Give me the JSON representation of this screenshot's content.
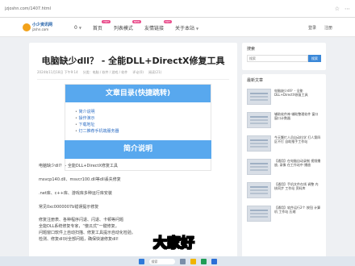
{
  "browser": {
    "url": "jzjoshn.com/1407.html"
  },
  "header": {
    "logo_cn": "小少资讯网",
    "logo_en": "jzshn.com",
    "nav": [
      {
        "label": "0",
        "caret": true,
        "badge": ""
      },
      {
        "label": "首页",
        "caret": false,
        "badge": "HOT"
      },
      {
        "label": "列表模式",
        "caret": false,
        "badge": "NEW"
      },
      {
        "label": "友情链接",
        "caret": false,
        "badge": "HOT"
      },
      {
        "label": "关于本站",
        "caret": true,
        "badge": ""
      }
    ],
    "login": "登录",
    "register": "注册"
  },
  "article": {
    "title": "电脑缺少dll？ - 全能DLL+DirectX修复工具",
    "meta": [
      "2024年11月18日 下午9:14",
      "分类：电脑 / 软件 / 游戏 / 软件",
      "评论(0)",
      "阅读(21)"
    ],
    "toc_title": "文章目录(快捷跳转)",
    "toc": [
      "简介说明",
      "操作演示",
      "下载地址",
      "灯二推荐手机端服务器"
    ],
    "intro_title": "简介说明",
    "paras": [
      "电脑缺少dll？ - 全能DLL+DirectX修复工具",
      "msvcp140.dll、msvcr100.dll等dll丢失修复",
      ".net库、c++库、游戏库多种运行库安装",
      "常见0xc0000007b错误提示修复",
      "修复注册表、各种程序闪退、闪退、卡顿等问题",
      "全能DLL系统修复专家，“傻瓜式”一键修复。",
      "问题窗口软件上自动扫描、修复工具提示自动化检验。",
      "检测、修复dll对全部问题，确保快速修复dll!"
    ]
  },
  "sidebar": {
    "search_label": "搜索",
    "search_placeholder": "搜索",
    "search_button": "搜索",
    "recent_label": "最新文章",
    "recent": [
      "电脑缺少dll？- 全能DLL+DirectX修复工具",
      "辅助软件神 辅助整理软件 窗口 窗口计数器",
      "今天繁忙人员自动拉学 打人第四区不打 自助推手工作站",
      "【通用】在电脑自动录制 视频播放, 录像 在工作站中 播放",
      "【通用】手机文件在线 调整 内核同步 工作站 资料库",
      "【通用】软件运行2个 按钮 计算机 工作站 压缩"
    ]
  },
  "subtitle": "大家好",
  "taskbar": {
    "search": "搜索"
  },
  "colors": {
    "accent": "#58a8ee",
    "link": "#2f6fc5",
    "badge": "#e94b8a"
  }
}
